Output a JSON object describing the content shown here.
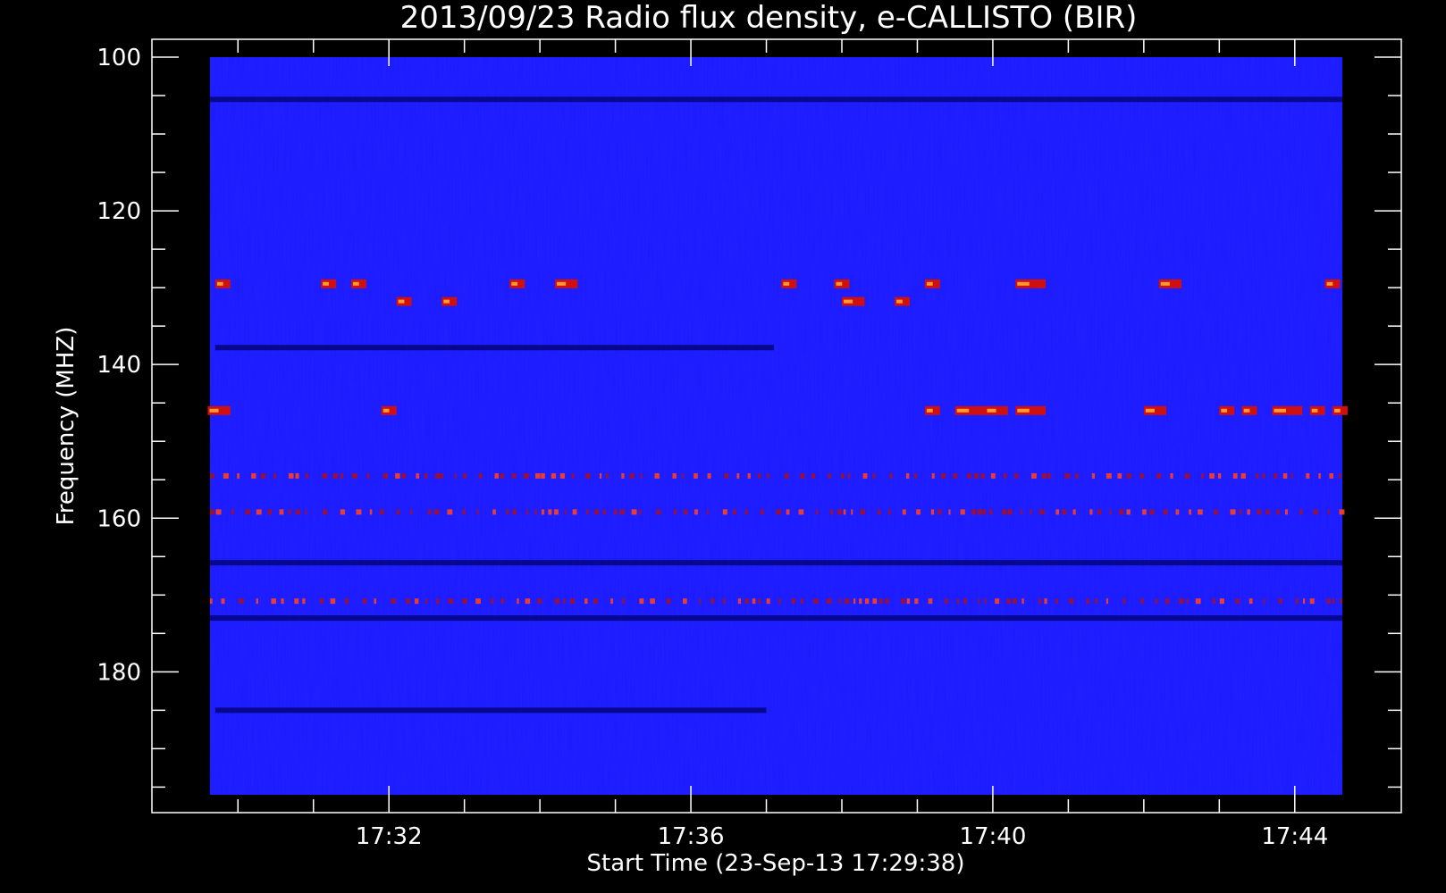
{
  "chart_data": {
    "type": "heatmap",
    "title": "2013/09/23  Radio flux density, e-CALLISTO (BIR)",
    "xlabel": "Start Time (23-Sep-13 17:29:38)",
    "ylabel": "Frequency (MHZ)",
    "x_range_minutes": [
      "17:29:38",
      "17:44:38"
    ],
    "xlim": [
      29.63,
      44.63
    ],
    "ylim": [
      100,
      196
    ],
    "y_inverted": true,
    "x_ticks": [
      "17:32",
      "17:36",
      "17:40",
      "17:44"
    ],
    "x_tick_values": [
      32,
      36,
      40,
      44
    ],
    "y_ticks": [
      "100",
      "120",
      "140",
      "160",
      "180"
    ],
    "y_tick_values": [
      100,
      120,
      140,
      160,
      180
    ],
    "colormap": [
      "#000010",
      "#0000ff",
      "#ff0000",
      "#ffff80"
    ],
    "background_level": "#1a1aff",
    "bright_bands_mhz": [
      {
        "freq": 105.5,
        "level": "dark"
      },
      {
        "freq": 129.5,
        "level": "bright",
        "spans": [
          [
            29.7,
            29.9
          ],
          [
            31.1,
            31.3
          ],
          [
            31.5,
            31.7
          ],
          [
            33.6,
            33.8
          ],
          [
            34.2,
            34.5
          ],
          [
            37.2,
            37.4
          ],
          [
            37.9,
            38.1
          ],
          [
            39.1,
            39.3
          ],
          [
            40.3,
            40.7
          ],
          [
            42.2,
            42.5
          ],
          [
            44.4,
            44.6
          ]
        ]
      },
      {
        "freq": 131.8,
        "level": "bright",
        "spans": [
          [
            32.1,
            32.3
          ],
          [
            32.7,
            32.9
          ],
          [
            38.0,
            38.3
          ],
          [
            38.7,
            38.9
          ]
        ]
      },
      {
        "freq": 137.8,
        "level": "dark",
        "spans": [
          [
            29.7,
            37.1
          ]
        ]
      },
      {
        "freq": 146.0,
        "level": "bright",
        "spans": [
          [
            29.6,
            29.9
          ],
          [
            31.9,
            32.1
          ],
          [
            39.1,
            39.3
          ],
          [
            39.5,
            39.9
          ],
          [
            39.9,
            40.2
          ],
          [
            40.3,
            40.7
          ],
          [
            42.0,
            42.3
          ],
          [
            43.0,
            43.2
          ],
          [
            43.3,
            43.5
          ],
          [
            43.7,
            44.1
          ],
          [
            44.2,
            44.4
          ],
          [
            44.5,
            44.7
          ]
        ]
      },
      {
        "freq": 154.5,
        "level": "speckle"
      },
      {
        "freq": 159.2,
        "level": "speckle"
      },
      {
        "freq": 165.8,
        "level": "dark"
      },
      {
        "freq": 170.8,
        "level": "speckle"
      },
      {
        "freq": 173.0,
        "level": "dark"
      },
      {
        "freq": 185.0,
        "level": "dark",
        "spans": [
          [
            29.7,
            37.0
          ]
        ]
      }
    ]
  }
}
